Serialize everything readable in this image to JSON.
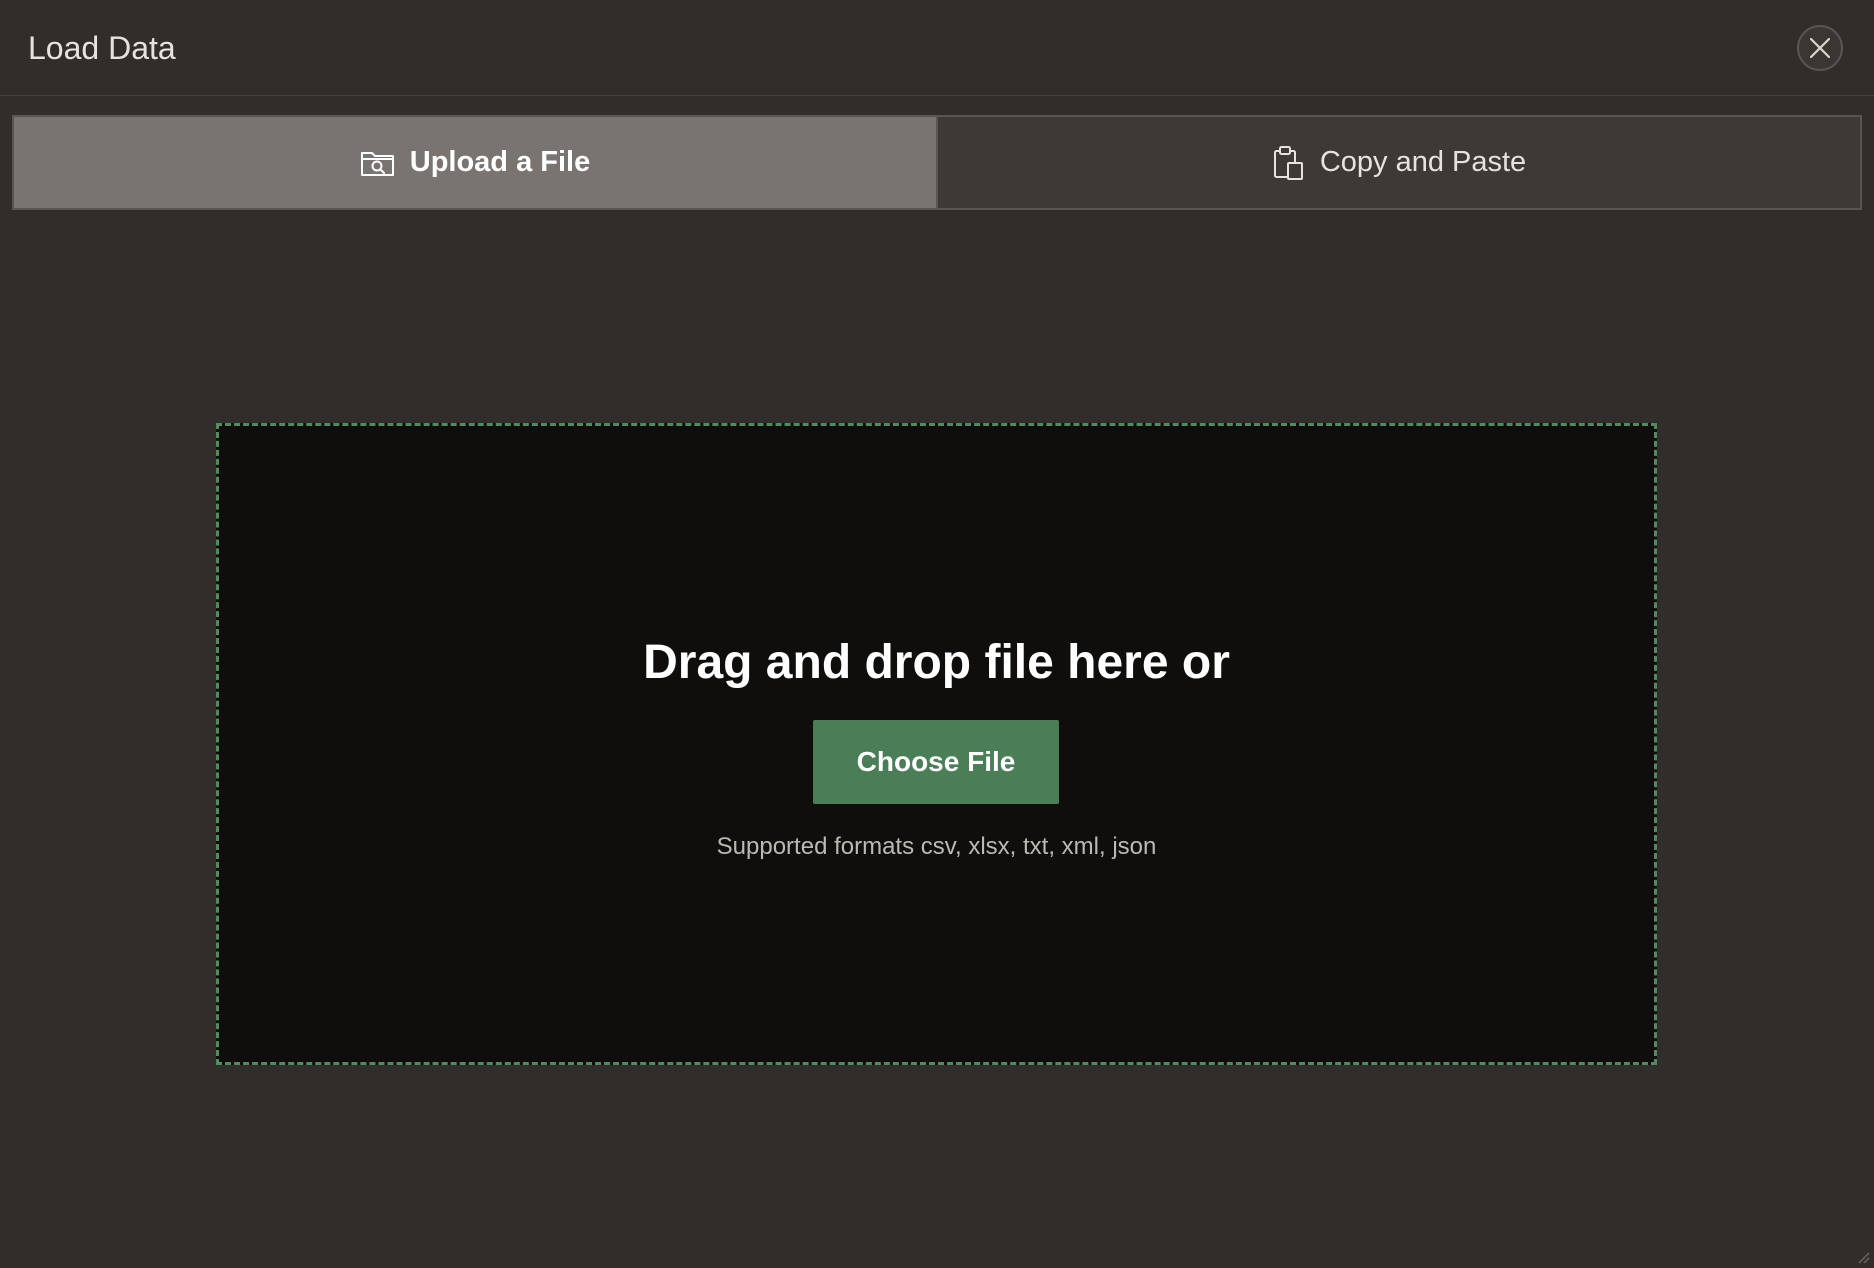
{
  "dialog": {
    "title": "Load Data",
    "close_icon": "close-icon"
  },
  "tabs": [
    {
      "label": "Upload a File",
      "icon": "folder-search-icon",
      "active": true
    },
    {
      "label": "Copy and Paste",
      "icon": "clipboard-icon",
      "active": false
    }
  ],
  "dropzone": {
    "heading": "Drag and drop file here or",
    "button_label": "Choose File",
    "formats_text": "Supported formats csv, xlsx, txt, xml, json"
  },
  "colors": {
    "background": "#312d2a",
    "active_tab": "#7a7470",
    "dropzone_bg": "#0f0e0d",
    "dropzone_border": "#4e8c5c",
    "primary_button": "#4a7e57"
  }
}
